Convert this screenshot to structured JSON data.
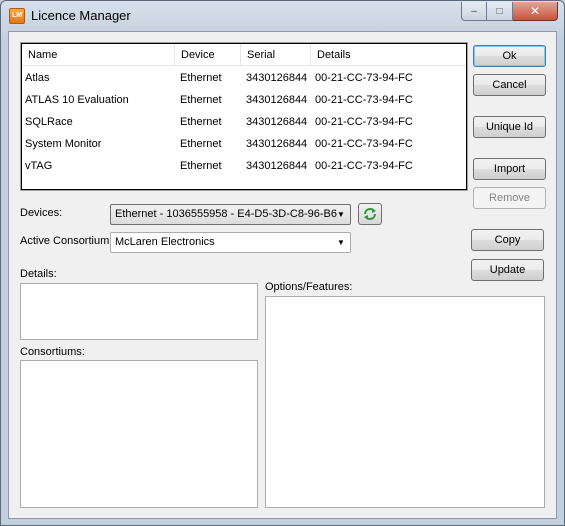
{
  "window": {
    "title": "Licence Manager",
    "icon_text": "LM",
    "minimize": "–",
    "maximize": "□",
    "close": "✕"
  },
  "licences": {
    "columns": [
      "Name",
      "Device",
      "Serial",
      "Details"
    ],
    "rows": [
      {
        "name": "Atlas",
        "device": "Ethernet",
        "serial": "3430126844",
        "details": "00-21-CC-73-94-FC"
      },
      {
        "name": "ATLAS 10 Evaluation",
        "device": "Ethernet",
        "serial": "3430126844",
        "details": "00-21-CC-73-94-FC"
      },
      {
        "name": "SQLRace",
        "device": "Ethernet",
        "serial": "3430126844",
        "details": "00-21-CC-73-94-FC"
      },
      {
        "name": "System Monitor",
        "device": "Ethernet",
        "serial": "3430126844",
        "details": "00-21-CC-73-94-FC"
      },
      {
        "name": "vTAG",
        "device": "Ethernet",
        "serial": "3430126844",
        "details": "00-21-CC-73-94-FC"
      }
    ]
  },
  "buttons": {
    "ok": "Ok",
    "cancel": "Cancel",
    "unique_id": "Unique Id",
    "import": "Import",
    "remove": "Remove",
    "copy": "Copy",
    "update": "Update"
  },
  "devices": {
    "label": "Devices:",
    "value": "Ethernet - 1036555958 - E4-D5-3D-C8-96-B6"
  },
  "consortium": {
    "label": "Active Consortium:",
    "value": "McLaren Electronics"
  },
  "details_label": "Details:",
  "consortiums_label": "Consortiums:",
  "options_label": "Options/Features:",
  "colors": {
    "refresh_green": "#2e9b3a",
    "default_button_border": "#3c7fb1"
  }
}
